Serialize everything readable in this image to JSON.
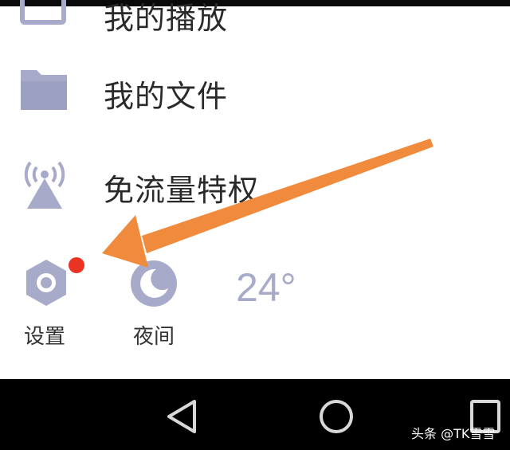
{
  "menu": {
    "items": [
      {
        "label": "我的播放",
        "icon": "play-history-icon"
      },
      {
        "label": "我的文件",
        "icon": "folder-icon"
      },
      {
        "label": "免流量特权",
        "icon": "signal-tower-icon"
      }
    ]
  },
  "tools": {
    "settings": {
      "label": "设置",
      "icon": "gear-icon",
      "has_notification": true
    },
    "night": {
      "label": "夜间",
      "icon": "moon-icon"
    },
    "weather": {
      "temperature": "24°"
    }
  },
  "nav": {
    "back": "back-icon",
    "home": "home-icon",
    "recent": "recent-apps-icon"
  },
  "watermark": {
    "text": "头条 @TK雪雪"
  },
  "colors": {
    "icon": "#a7abc9",
    "text": "#2a2a2a",
    "badge": "#ea3323",
    "arrow": "#f08a3c",
    "nav_bar": "#000000"
  }
}
